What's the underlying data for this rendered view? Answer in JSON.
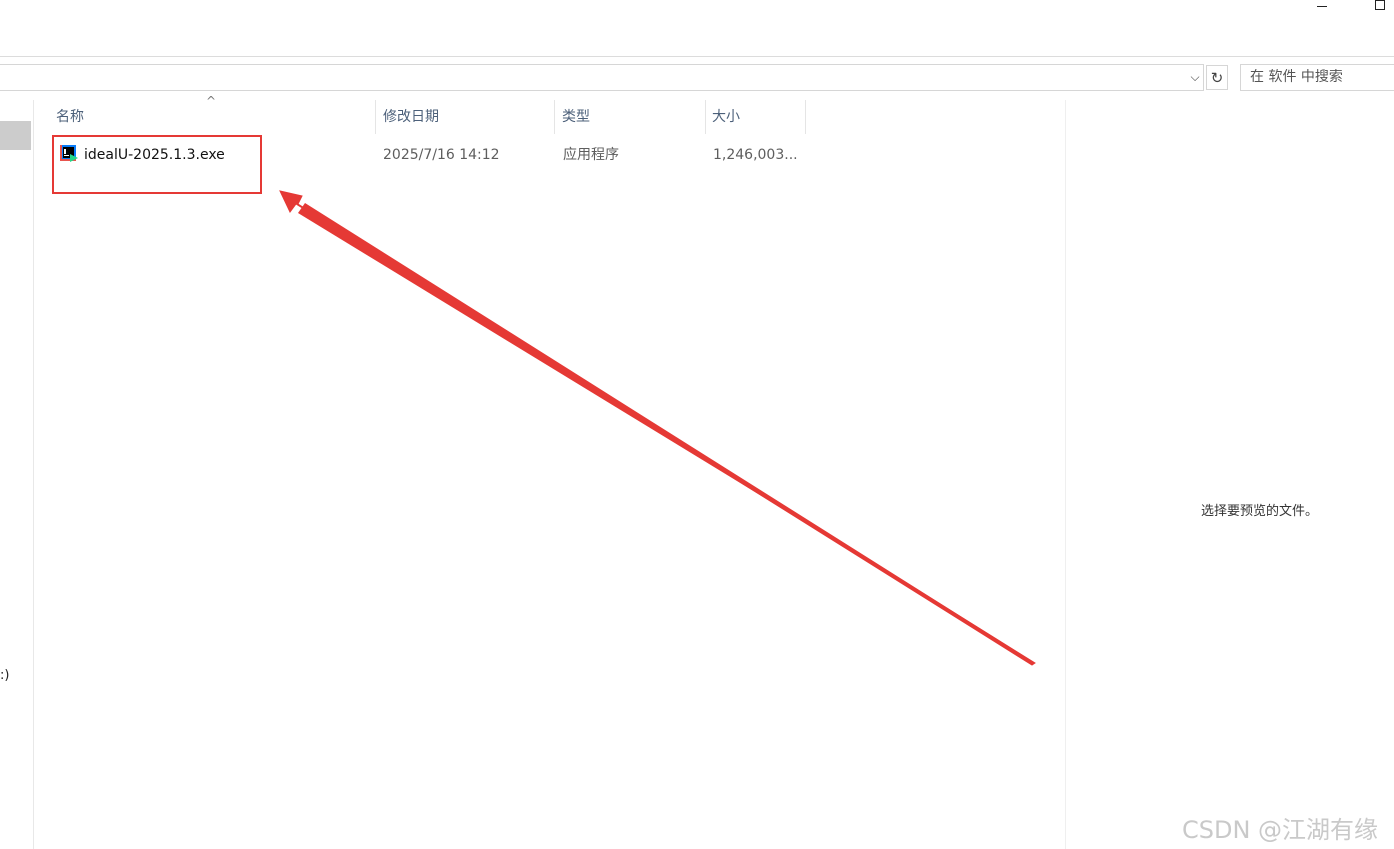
{
  "window": {
    "minimize_icon": "minimize-icon",
    "maximize_icon": "maximize-icon"
  },
  "address": {
    "chevron_icon": "chevron-down-icon",
    "refresh_icon": "refresh-icon",
    "refresh_glyph": "↻",
    "chevron_glyph": "⌵"
  },
  "search": {
    "placeholder": "在 软件 中搜索"
  },
  "nav": {
    "drive_label": ":)"
  },
  "columns": {
    "name": "名称",
    "date": "修改日期",
    "type": "类型",
    "size": "大小",
    "sort_indicator": "^"
  },
  "files": [
    {
      "name": "idealU-2025.1.3.exe",
      "modified": "2025/7/16 14:12",
      "type": "应用程序",
      "size": "1,246,003...",
      "icon": "intellij-idea-installer-icon"
    }
  ],
  "preview": {
    "empty_text": "选择要预览的文件。"
  },
  "annotation": {
    "color": "#e53935"
  },
  "watermark": "CSDN @江湖有缘"
}
